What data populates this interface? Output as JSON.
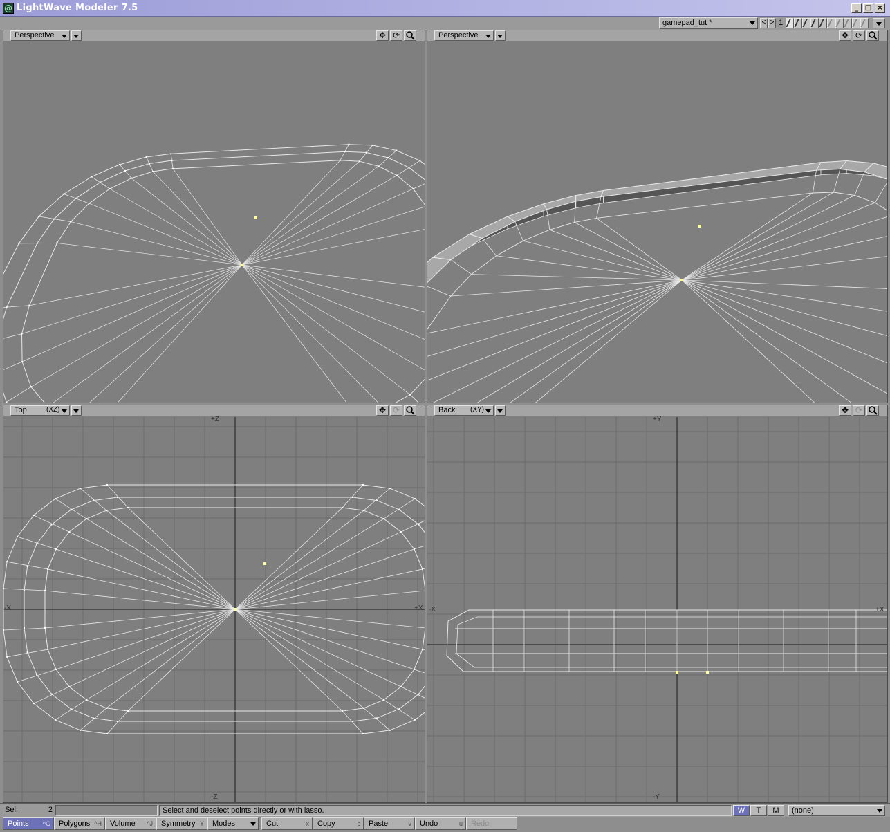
{
  "window": {
    "title": "LightWave Modeler 7.5",
    "icon_glyph": "@",
    "controls": [
      "_",
      "□",
      "×"
    ]
  },
  "topbar": {
    "object_name": "gamepad_tut *",
    "prev_label": "<",
    "next_label": ">",
    "layer_number": "1"
  },
  "viewports": {
    "top_left": {
      "mode": "Perspective",
      "axis": ""
    },
    "top_right": {
      "mode": "Perspective",
      "axis": ""
    },
    "bottom_left": {
      "mode": "Top",
      "axis": "(XZ)",
      "labels": {
        "top": "+Z",
        "bottom": "-Z",
        "left": "-X",
        "right": "+X"
      }
    },
    "bottom_right": {
      "mode": "Back",
      "axis": "(XY)",
      "labels": {
        "top": "+Y",
        "bottom": "-Y",
        "left": "-X",
        "right": "+X"
      }
    }
  },
  "tool_icons": {
    "move": "✥",
    "rotate": "⟳",
    "zoom": "🔍"
  },
  "statusbar": {
    "sel_label": "Sel:",
    "sel_count": "2",
    "message": "Select and deselect points directly or with lasso.",
    "wtm": [
      "W",
      "T",
      "M"
    ],
    "surface": "(none)"
  },
  "bottombar": {
    "buttons": [
      {
        "label": "Points",
        "shortcut": "^G"
      },
      {
        "label": "Polygons",
        "shortcut": "^H"
      },
      {
        "label": "Volume",
        "shortcut": "^J"
      },
      {
        "label": "Symmetry",
        "shortcut": "Y"
      },
      {
        "label": "Modes",
        "shortcut": ""
      },
      {
        "label": "Cut",
        "shortcut": "x"
      },
      {
        "label": "Copy",
        "shortcut": "c"
      },
      {
        "label": "Paste",
        "shortcut": "v"
      },
      {
        "label": "Undo",
        "shortcut": "u"
      },
      {
        "label": "Redo",
        "shortcut": ""
      }
    ]
  },
  "colors": {
    "viewport_bg": "#7f7f7f",
    "wire": "#e8e8e8",
    "grid": "#6b6b6b",
    "axis": "#1a1a1a",
    "selected_point": "#ffffa0",
    "accent": "#6d72b8"
  }
}
